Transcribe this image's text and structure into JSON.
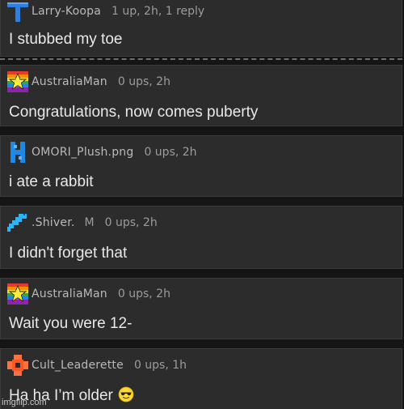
{
  "comments": [
    {
      "username": "Larry-Koopa",
      "meta": "1 up, 2h, 1 reply",
      "tag": "",
      "text": "I stubbed my toe",
      "avatar_icon": "blue-pixel-t-icon"
    },
    {
      "username": "AustraliaMan",
      "meta": "0 ups, 2h",
      "tag": "",
      "text": "Congratulations, now comes puberty",
      "avatar_icon": "rainbow-star-icon"
    },
    {
      "username": "OMORI_Plush.png",
      "meta": "0 ups, 2h",
      "tag": "",
      "text": "i ate a rabbit",
      "avatar_icon": "blue-pixel-glyph-icon"
    },
    {
      "username": ".Shiver.",
      "meta": "0 ups, 2h",
      "tag": "M",
      "text": "I didn't forget that",
      "avatar_icon": "blue-pixel-bird-icon"
    },
    {
      "username": "AustraliaMan",
      "meta": "0 ups, 2h",
      "tag": "",
      "text": "Wait you were 12-",
      "avatar_icon": "rainbow-star-icon"
    },
    {
      "username": "Cult_Leaderette",
      "meta": "0 ups, 1h",
      "tag": "",
      "text": "Ha ha I’m older",
      "avatar_icon": "orange-pixel-flower-icon",
      "emoji": "sunglasses-face-icon"
    }
  ],
  "watermark": "imgflip.com",
  "colors": {
    "background": "#151515",
    "card": "#2c2c2c",
    "username": "#b9b9b9",
    "meta": "#9c9c9c",
    "text": "#e8e8e8"
  }
}
